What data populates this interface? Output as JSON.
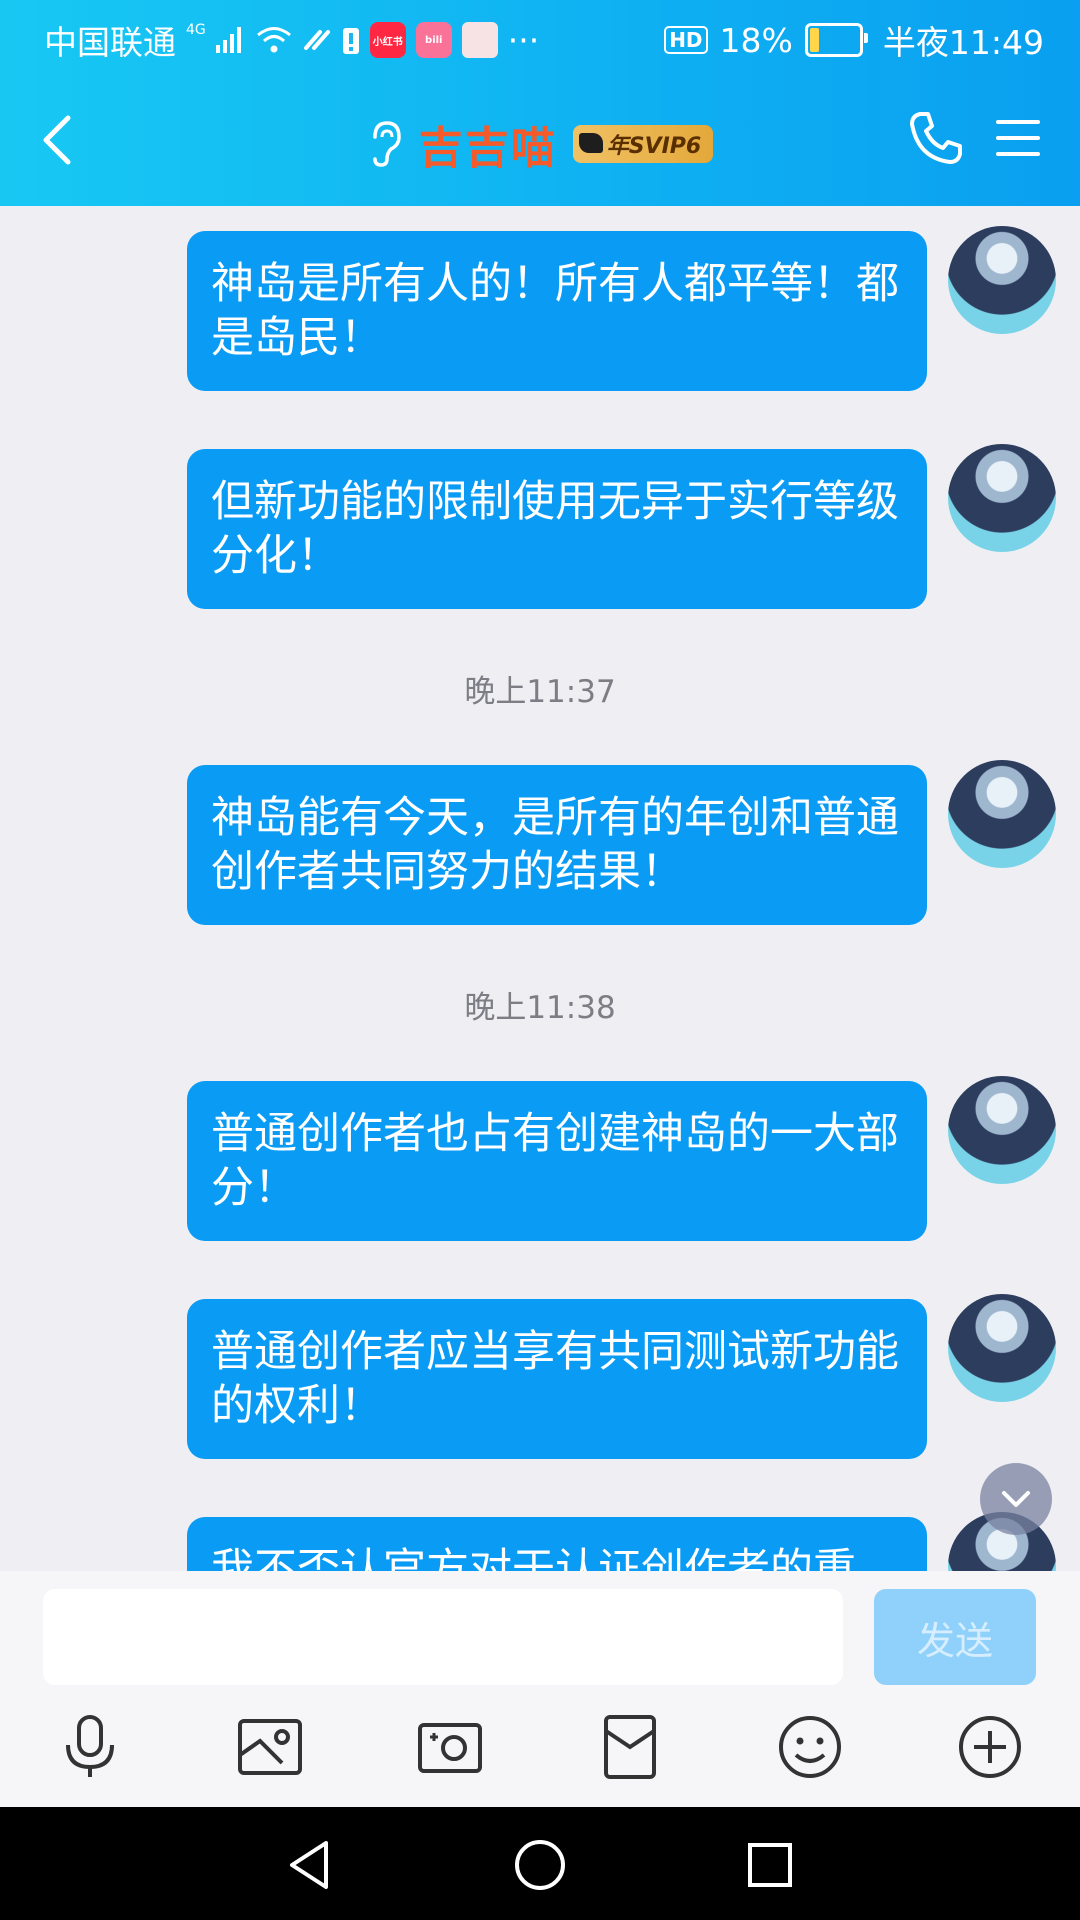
{
  "status_bar": {
    "carrier": "中国联通",
    "network": "4G",
    "more": "···",
    "hd": "HD",
    "battery_percent_text": "18%",
    "battery_level": 0.18,
    "time": "半夜11:49"
  },
  "header": {
    "title": "吉吉喵",
    "vip_badge": "年SVIP6"
  },
  "messages": [
    {
      "type": "message",
      "text": "神岛是所有人的！所有人都平等！都是岛民！"
    },
    {
      "type": "message",
      "text": "但新功能的限制使用无异于实行等级分化！"
    },
    {
      "type": "timestamp",
      "text": "晚上11:37"
    },
    {
      "type": "message",
      "text": "神岛能有今天，是所有的年创和普通创作者共同努力的结果！"
    },
    {
      "type": "timestamp",
      "text": "晚上11:38"
    },
    {
      "type": "message",
      "text": "普通创作者也占有创建神岛的一大部分！"
    },
    {
      "type": "message",
      "text": "普通创作者应当享有共同测试新功能的权利！"
    },
    {
      "type": "message",
      "text": "我不否认官方对于认证创作者的重"
    }
  ],
  "input": {
    "value": "",
    "send_label": "发送"
  },
  "colors": {
    "header_start": "#18c8f3",
    "header_end": "#0a9ff0",
    "bubble": "#0a9bf5",
    "title": "#f45a2a"
  },
  "toolbar_icons": [
    "microphone-icon",
    "image-icon",
    "camera-icon",
    "red-packet-icon",
    "emoji-icon",
    "plus-icon"
  ]
}
